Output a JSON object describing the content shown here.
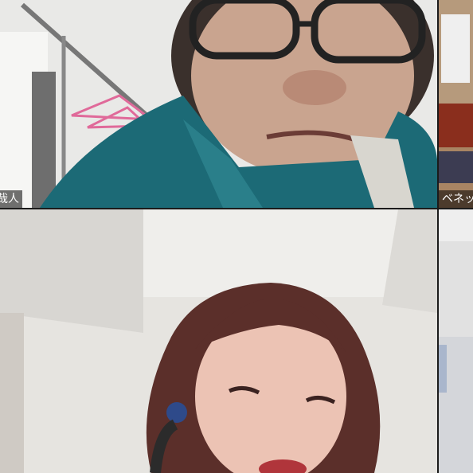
{
  "participants": [
    {
      "name": "哉人",
      "label": "哉人"
    },
    {
      "name": "ベネッ",
      "label": "ベネッ"
    }
  ],
  "colors": {
    "tile_gap": "#1b1b1b",
    "name_tag_bg": "rgba(0,0,0,0.55)"
  }
}
